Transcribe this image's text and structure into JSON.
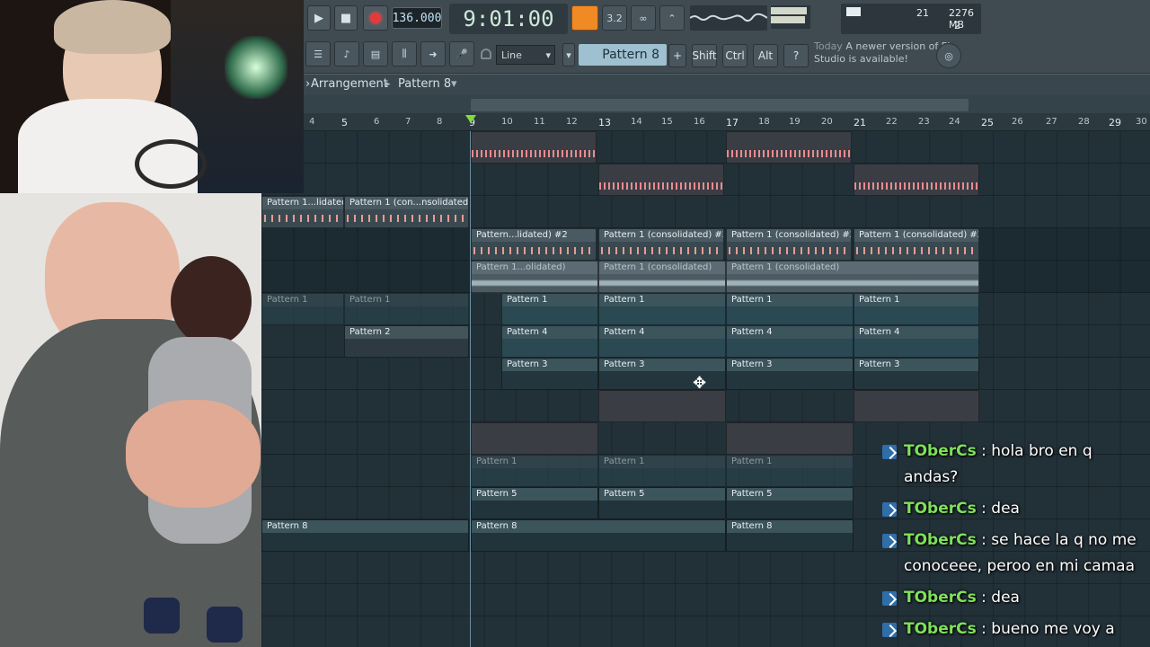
{
  "toolbar": {
    "tempo": "136.000",
    "song_time": "9:01:00",
    "cpu_value": "21",
    "memory": "2276 MB",
    "poly": "2",
    "snap_mode": "Line",
    "pattern_selector": "Pattern 8",
    "shift_label": "Shift",
    "ctrl_label": "Ctrl",
    "alt_label": "Alt",
    "news_when": "Today",
    "news_text": "A newer version of FL Studio is available!"
  },
  "playlist": {
    "title": "Arrangement",
    "current_pattern": "Pattern 8",
    "bar_numbers": [
      "4",
      "5",
      "6",
      "7",
      "8",
      "9",
      "10",
      "11",
      "12",
      "13",
      "14",
      "15",
      "16",
      "17",
      "18",
      "19",
      "20",
      "21",
      "22",
      "23",
      "24",
      "25",
      "26",
      "27",
      "28",
      "29",
      "30"
    ]
  },
  "clips": {
    "pat1_lidated": "Pattern 1...lidated)",
    "pat1_con_nsolidated": "Pattern 1 (con...nsolidated)",
    "pattern_lidated_2": "Pattern...lidated) #2",
    "pattern1_consolidated_2": "Pattern 1 (consolidated) #2",
    "pattern1_olidated": "Pattern 1...olidated)",
    "pattern1_consolidated": "Pattern 1 (consolidated)",
    "pattern1": "Pattern 1",
    "pattern2": "Pattern 2",
    "pattern3": "Pattern 3",
    "pattern4": "Pattern 4",
    "pattern5": "Pattern 5",
    "pattern8": "Pattern 8",
    "x_pattern1": "Pattern 1"
  },
  "chat": [
    {
      "user": "TOberCs",
      "text": "hola bro en q andas?"
    },
    {
      "user": "TOberCs",
      "text": "dea"
    },
    {
      "user": "TOberCs",
      "text": "se hace la q no me conoceee, peroo en mi camaa"
    },
    {
      "user": "TOberCs",
      "text": "dea"
    },
    {
      "user": "TOberCs",
      "text": "bueno me voy a dormir basta"
    }
  ]
}
